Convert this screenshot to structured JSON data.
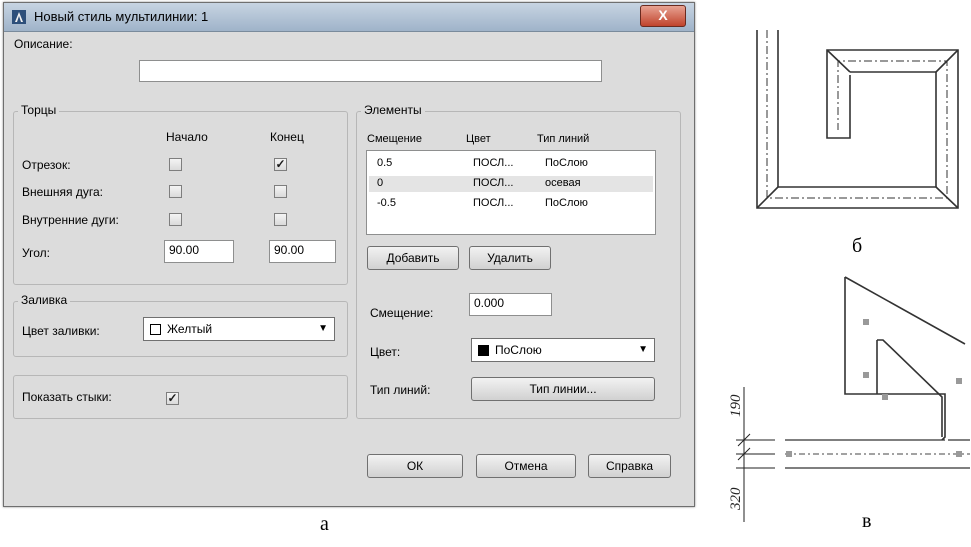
{
  "dialog": {
    "title": "Новый стиль мультилинии: 1",
    "close_glyph": "X",
    "description_label": "Описание:",
    "description_value": ""
  },
  "caps": {
    "title": "Торцы",
    "col_start": "Начало",
    "col_end": "Конец",
    "rows": [
      {
        "label": "Отрезок:",
        "start": false,
        "end": true
      },
      {
        "label": "Внешняя дуга:",
        "start": false,
        "end": false
      },
      {
        "label": "Внутренние дуги:",
        "start": false,
        "end": false
      }
    ],
    "angle_label": "Угол:",
    "angle_start": "90.00",
    "angle_end": "90.00"
  },
  "fill": {
    "title": "Заливка",
    "color_label": "Цвет заливки:",
    "color_value": "Желтый"
  },
  "joints": {
    "label": "Показать стыки:",
    "checked": true
  },
  "elements": {
    "title": "Элементы",
    "headers": [
      "Смещение",
      "Цвет",
      "Тип линий"
    ],
    "rows": [
      {
        "offset": "0.5",
        "color": "ПОСЛ...",
        "linetype": "ПоСлою"
      },
      {
        "offset": "0",
        "color": "ПОСЛ...",
        "linetype": "осевая"
      },
      {
        "offset": "-0.5",
        "color": "ПОСЛ...",
        "linetype": "ПоСлою"
      }
    ],
    "selected_row": 1,
    "add_button": "Добавить",
    "delete_button": "Удалить",
    "offset_label": "Смещение:",
    "offset_value": "0.000",
    "color_label": "Цвет:",
    "color_value": "ПоСлою",
    "linetype_label": "Тип линий:",
    "linetype_button": "Тип линии..."
  },
  "buttons": {
    "ok": "ОК",
    "cancel": "Отмена",
    "help": "Справка"
  },
  "captions": {
    "a": "а",
    "b": "б",
    "v": "в"
  },
  "dimensions": {
    "top": "190",
    "bottom": "320"
  },
  "colors": {
    "fill_swatch": "#ffffff",
    "linetype_swatch": "#000000"
  }
}
